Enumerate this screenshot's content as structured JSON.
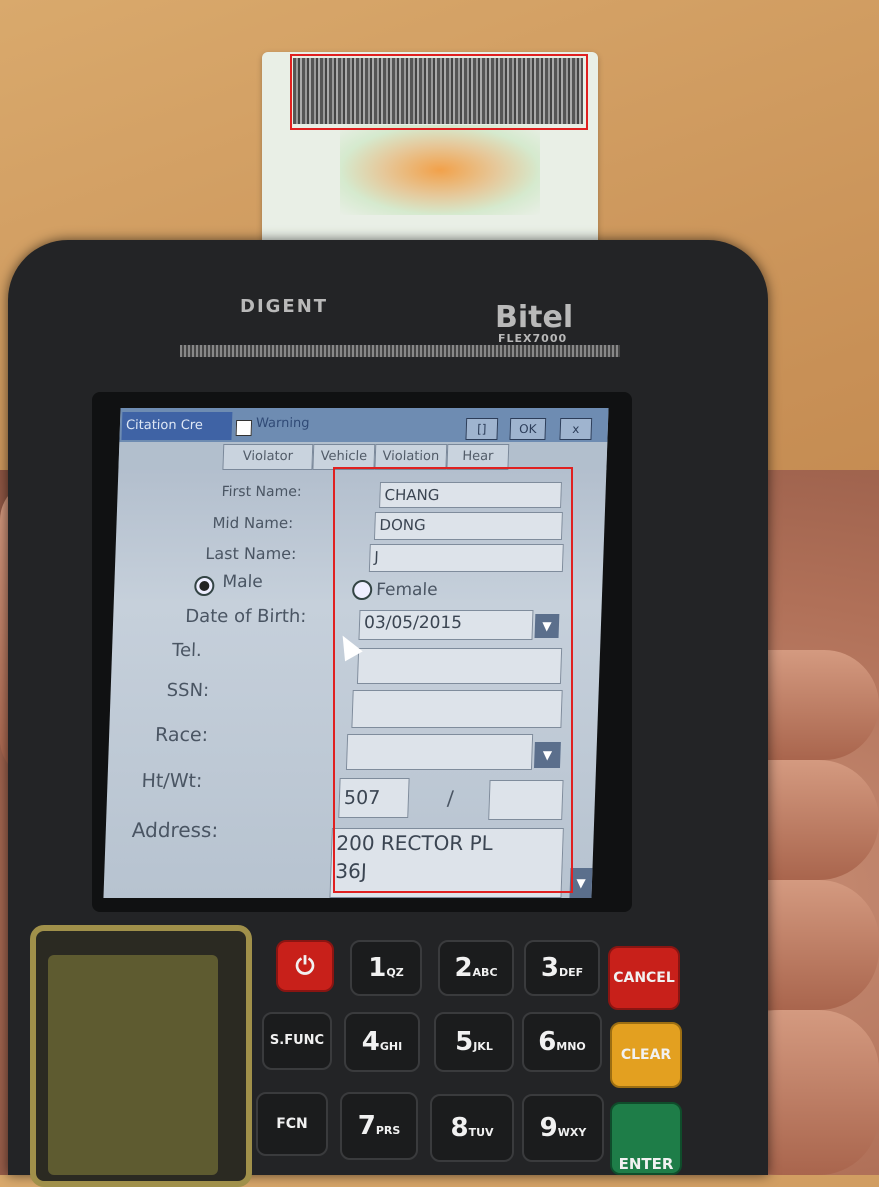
{
  "device": {
    "brand_left": "DIGENT",
    "brand_right": "Bitel",
    "model": "FLEX7000"
  },
  "window": {
    "title": "Citation Cre",
    "warning_label": "Warning",
    "buttons": [
      "[]",
      "OK",
      "x"
    ],
    "tabs": [
      "Violator",
      "Vehicle",
      "Violation",
      "Hear"
    ]
  },
  "form": {
    "first_name": {
      "label": "First Name:",
      "value": "CHANG"
    },
    "mid_name": {
      "label": "Mid Name:",
      "value": "DONG"
    },
    "last_name": {
      "label": "Last Name:",
      "value": "J"
    },
    "gender": {
      "male_label": "Male",
      "female_label": "Female",
      "selected": "Male"
    },
    "dob": {
      "label": "Date of Birth:",
      "value": "03/05/2015"
    },
    "tel": {
      "label": "Tel.",
      "value": ""
    },
    "ssn": {
      "label": "SSN:",
      "value": ""
    },
    "race": {
      "label": "Race:",
      "value": ""
    },
    "htwt": {
      "label": "Ht/Wt:",
      "height": "507",
      "sep": "/",
      "weight": ""
    },
    "address": {
      "label": "Address:",
      "line1": "200 RECTOR PL",
      "line2": "36J"
    }
  },
  "keypad": {
    "row1": [
      {
        "big": "1",
        "sm": "QZ"
      },
      {
        "big": "2",
        "sm": "ABC"
      },
      {
        "big": "3",
        "sm": "DEF"
      }
    ],
    "row2": [
      {
        "big": "4",
        "sm": "GHI"
      },
      {
        "big": "5",
        "sm": "JKL"
      },
      {
        "big": "6",
        "sm": "MNO"
      }
    ],
    "row3": [
      {
        "big": "7",
        "sm": "PRS"
      },
      {
        "big": "8",
        "sm": "TUV"
      },
      {
        "big": "9",
        "sm": "WXY"
      }
    ],
    "sfunc": "S.FUNC",
    "fcn": "FCN",
    "cancel": "CANCEL",
    "clear": "CLEAR",
    "enter": "ENTER",
    "power": "⏻"
  },
  "colors": {
    "highlight": "#e02020",
    "cancel": "#c8201a",
    "clear": "#e3a020",
    "enter": "#1e7d48"
  }
}
